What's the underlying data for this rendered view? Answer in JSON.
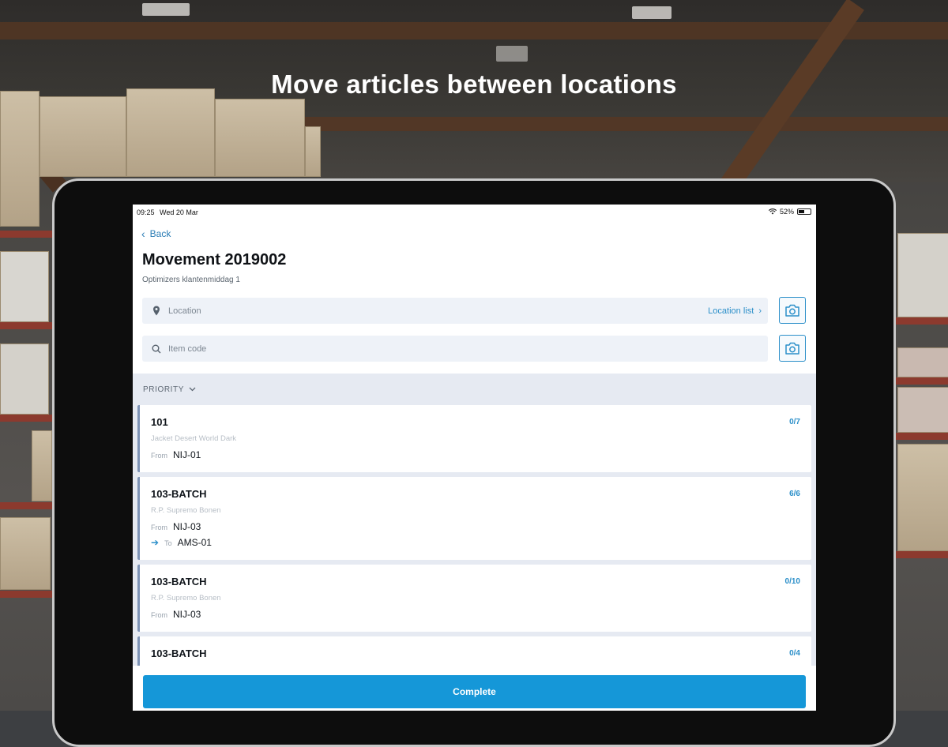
{
  "headline": "Move articles between locations",
  "status_bar": {
    "time": "09:25",
    "date": "Wed 20 Mar",
    "battery": "52%",
    "battery_level": 0.52
  },
  "nav": {
    "back_label": "Back"
  },
  "page": {
    "title": "Movement 2019002",
    "subtitle": "Optimizers klantenmiddag 1"
  },
  "location_field": {
    "placeholder": "Location",
    "link_label": "Location list",
    "icon": "map-pin-icon"
  },
  "item_field": {
    "placeholder": "Item code",
    "icon": "search-icon"
  },
  "sort": {
    "label": "PRIORITY",
    "icon": "chevron-down-icon"
  },
  "items": [
    {
      "code": "101",
      "description": "Jacket Desert World Dark",
      "count": "0/7",
      "from_label": "From",
      "from": "NIJ-01"
    },
    {
      "code": "103-BATCH",
      "description": "R.P. Supremo Bonen",
      "count": "6/6",
      "from_label": "From",
      "from": "NIJ-03",
      "to_label": "To",
      "to": "AMS-01"
    },
    {
      "code": "103-BATCH",
      "description": "R.P. Supremo Bonen",
      "count": "0/10",
      "from_label": "From",
      "from": "NIJ-03"
    },
    {
      "code": "103-BATCH",
      "count": "0/4"
    }
  ],
  "actions": {
    "complete_label": "Complete"
  },
  "colors": {
    "accent": "#1597d8",
    "link": "#2b8fc9",
    "card_border": "#7d93b6",
    "list_bg": "#e6eaf2"
  }
}
